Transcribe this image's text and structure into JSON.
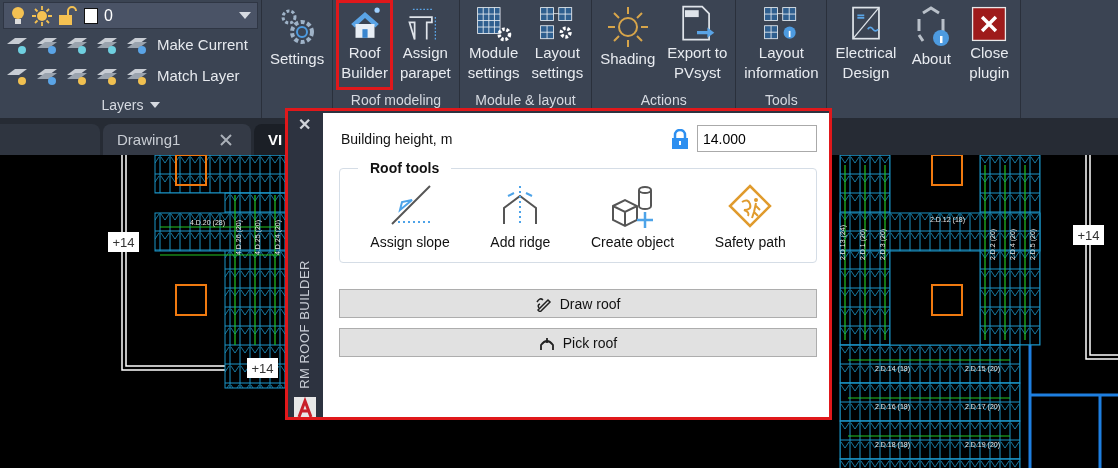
{
  "layers": {
    "layer_name": "0",
    "row_buttons": [
      "Make Current",
      "Match Layer"
    ],
    "panel_label": "Layers"
  },
  "ribbon_panels": [
    {
      "buttons": [
        {
          "kind": "settings",
          "lines": [
            "Settings"
          ],
          "selected": false
        }
      ]
    },
    {
      "label": "Roof modeling",
      "buttons": [
        {
          "kind": "roof",
          "lines": [
            "Roof",
            "Builder"
          ],
          "selected": true
        },
        {
          "kind": "parapet",
          "lines": [
            "Assign",
            "parapet"
          ],
          "selected": false
        }
      ]
    },
    {
      "label": "Module & layout",
      "buttons": [
        {
          "kind": "module",
          "lines": [
            "Module",
            "settings"
          ],
          "selected": false
        },
        {
          "kind": "layout",
          "lines": [
            "Layout",
            "settings"
          ],
          "selected": false
        }
      ]
    },
    {
      "label": "Actions",
      "buttons": [
        {
          "kind": "shading",
          "lines": [
            "Shading"
          ],
          "selected": false
        },
        {
          "kind": "export",
          "lines": [
            "Export to",
            "PVsyst"
          ],
          "selected": false
        }
      ]
    },
    {
      "label": "Tools",
      "buttons": [
        {
          "kind": "info",
          "lines": [
            "Layout",
            "information"
          ],
          "selected": false
        }
      ]
    },
    {
      "buttons": [
        {
          "kind": "electrical",
          "lines": [
            "Electrical",
            "Design"
          ],
          "selected": false
        },
        {
          "kind": "about",
          "lines": [
            "About"
          ],
          "selected": false
        },
        {
          "kind": "close",
          "lines": [
            "Close",
            "plugin"
          ],
          "selected": false
        }
      ]
    }
  ],
  "doc_tabs": [
    {
      "label": "Drawing1",
      "selected": false
    },
    {
      "label": "VI",
      "selected": true
    }
  ],
  "palette": {
    "close": "✕",
    "title": "RM ROOF BUILDER",
    "height_label": "Building height, m",
    "locked": true,
    "height_value": "14.000",
    "group_title": "Roof tools",
    "tools": [
      {
        "kind": "slope",
        "label": "Assign slope"
      },
      {
        "kind": "ridge",
        "label": "Add ridge"
      },
      {
        "kind": "object",
        "label": "Create object"
      },
      {
        "kind": "safety",
        "label": "Safety path"
      }
    ],
    "actions": [
      {
        "kind": "draw",
        "label": "Draw roof"
      },
      {
        "kind": "pick",
        "label": "Pick roof"
      }
    ]
  },
  "drawing": {
    "elevation_marks": [
      "+14",
      "+14",
      "+14"
    ],
    "string_labels": [
      "4.D.20 (28)",
      "2.D.12 (18)",
      "2.D.14 (18)",
      "2.D.15 (20)",
      "2.D.16 (18)",
      "2.D.17 (20)",
      "2.D.18 (18)",
      "2.D.19 (20)"
    ],
    "vertical_labels": [
      "4.D.26 (20)",
      "4.D.25 (20)",
      "4.D.24 (20)",
      "2.D.13 (24)",
      "2.D.1 (20)",
      "2.D.3 (20)",
      "2.D.2 (20)",
      "2.D.4 (20)",
      "2.D.5 (20)"
    ]
  }
}
